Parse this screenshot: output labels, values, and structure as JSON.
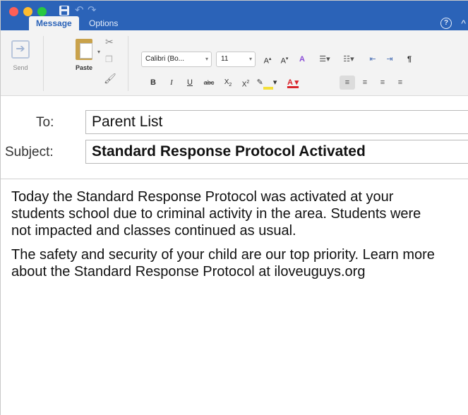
{
  "tabs": {
    "message": "Message",
    "options": "Options"
  },
  "title_icons": {
    "save": "save-icon",
    "undo": "undo-icon",
    "redo": "redo-icon"
  },
  "ribbon": {
    "send_label": "Send",
    "paste_label": "Paste",
    "font_name": "Calibri (Bo...",
    "font_size": "11"
  },
  "fields": {
    "to_label": "To:",
    "to_value": "Parent List",
    "subject_label": "Subject:",
    "subject_value": "Standard Response Protocol Activated"
  },
  "body": {
    "paragraph_1": "Today the Standard Response Protocol was activated at your students school due to criminal activity in the area. Students were not impacted and classes continued as usual.",
    "paragraph_2": "The safety and security of your child are our top priority. Learn more about the Standard Response Protocol at iloveuguys.org"
  },
  "colors": {
    "titlebar": "#2b63b8",
    "ribbon": "#f3f3f3"
  }
}
